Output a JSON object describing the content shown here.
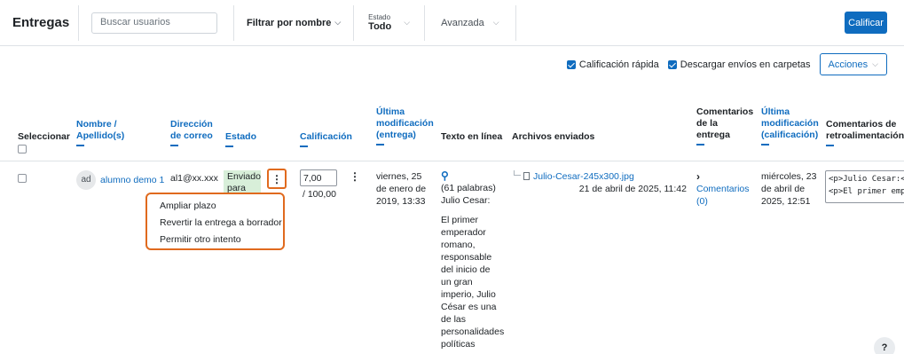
{
  "header": {
    "title": "Entregas",
    "search_placeholder": "Buscar usuarios",
    "filter_label": "Filtrar por nombre",
    "estado_label": "Estado",
    "estado_value": "Todo",
    "avanzada_label": "Avanzada",
    "calificar_label": "Calificar"
  },
  "options": {
    "quick_grading": "Calificación rápida",
    "download_folders": "Descargar envíos en carpetas",
    "acciones_label": "Acciones"
  },
  "columns": {
    "seleccionar": "Seleccionar",
    "nombre": "Nombre /",
    "apellidos": "Apellido(s)",
    "direccion": "Dirección",
    "de_correo": "de correo",
    "estado": "Estado",
    "calificacion": "Calificación",
    "ultima_mod_1": "Última",
    "ultima_mod_2": "modificación",
    "ultima_mod_3": "(entrega)",
    "texto": "Texto en línea",
    "archivos": "Archivos enviados",
    "comentarios_entrega_1": "Comentarios",
    "comentarios_entrega_2": "de la",
    "comentarios_entrega_3": "entrega",
    "ultima_cal_1": "Última",
    "ultima_cal_2": "modificación",
    "ultima_cal_3": "(calificación)",
    "feedback_1": "Comentarios de",
    "feedback_2": "retroalimentación"
  },
  "row": {
    "avatar_initials": "ad",
    "name": "alumno demo 1",
    "email": "al1@xx.xxx",
    "status": "Enviado para",
    "grade_value": "7,00",
    "grade_max": "/ 100,00",
    "last_mod_date": "viernes, 25 de enero de 2019, 13:33",
    "text_words": "(61 palabras)",
    "text_intro": "Julio Cesar:",
    "text_body": "El primer emperador romano, responsable del inicio de un gran imperio, Julio César es una de las personalidades políticas",
    "file_name": "Julio-Cesar-245x300.jpg",
    "file_date": "21 de abril de 2025, 11:42",
    "comments_link": "Comentarios (0)",
    "grade_mod_date": "miércoles, 23 de abril de 2025, 12:51",
    "feedback_line1": "<p>Julio Cesar:</p>",
    "feedback_line2": "<p>El primer emperador"
  },
  "menu": {
    "items": [
      "Ampliar plazo",
      "Revertir la entrega a borrador",
      "Permitir otro intento"
    ]
  },
  "help_label": "?"
}
